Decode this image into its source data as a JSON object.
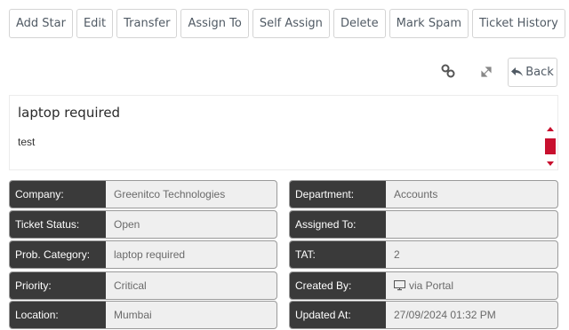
{
  "toolbar": {
    "buttons": [
      "Add Star",
      "Edit",
      "Transfer",
      "Assign To",
      "Self Assign",
      "Delete",
      "Mark Spam",
      "Ticket History"
    ]
  },
  "nav": {
    "back_label": "Back"
  },
  "ticket": {
    "subject": "laptop required",
    "description": "test"
  },
  "details": {
    "left": [
      {
        "label": "Company:",
        "value": "Greenitco Technologies"
      },
      {
        "label": "Ticket Status:",
        "value": "Open"
      },
      {
        "label": "Prob. Category:",
        "value": "laptop required"
      },
      {
        "label": "Priority:",
        "value": "Critical"
      },
      {
        "label": "Location:",
        "value": "Mumbai"
      }
    ],
    "right": [
      {
        "label": "Department:",
        "value": "Accounts"
      },
      {
        "label": "Assigned To:",
        "value": ""
      },
      {
        "label": "TAT:",
        "value": "2"
      },
      {
        "label": "Created By:",
        "value": "via Portal",
        "icon": "monitor-icon"
      },
      {
        "label": "Updated At:",
        "value": "27/09/2024 01:32 PM"
      }
    ]
  },
  "colors": {
    "label_bg": "#3a3a3a",
    "value_bg": "#efefef",
    "scroll_accent": "#c8102e"
  }
}
